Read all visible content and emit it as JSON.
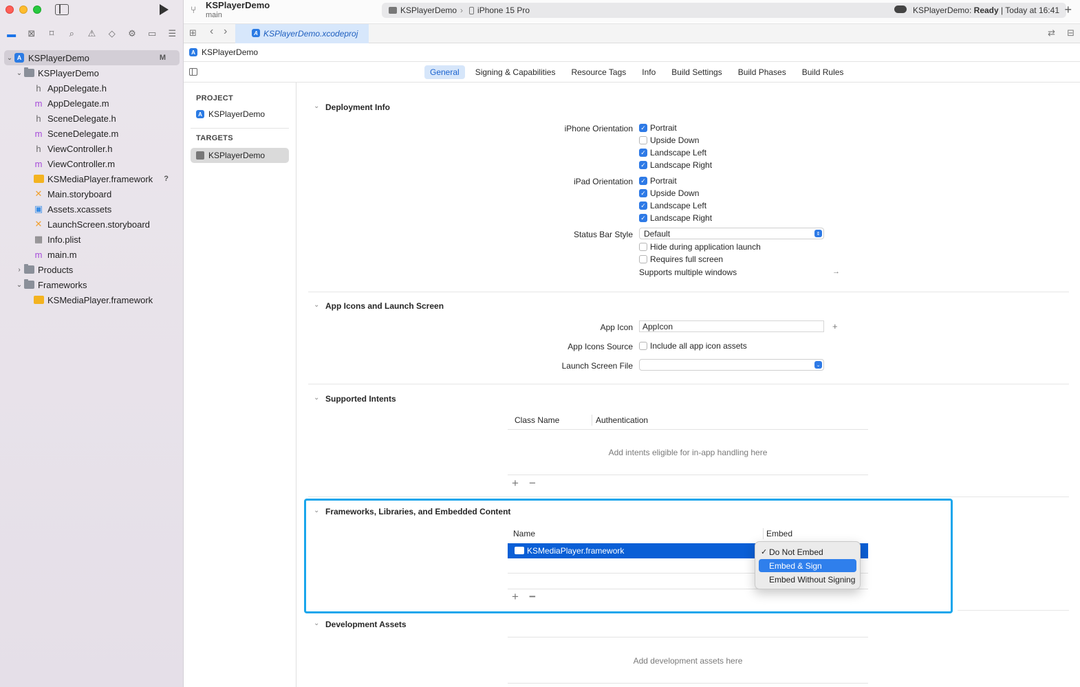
{
  "toolbar": {
    "project_name": "KSPlayerDemo",
    "branch": "main",
    "scheme": "KSPlayerDemo",
    "destination": "iPhone 15 Pro",
    "status_app": "KSPlayerDemo:",
    "status_state": "Ready",
    "status_time": "| Today at 16:41"
  },
  "tab": {
    "file": "KSPlayerDemo.xcodeproj"
  },
  "breadcrumb": {
    "item": "KSPlayerDemo"
  },
  "tree": [
    {
      "label": "KSPlayerDemo",
      "badge": "M"
    },
    {
      "label": "KSPlayerDemo"
    },
    {
      "label": "AppDelegate.h"
    },
    {
      "label": "AppDelegate.m"
    },
    {
      "label": "SceneDelegate.h"
    },
    {
      "label": "SceneDelegate.m"
    },
    {
      "label": "ViewController.h"
    },
    {
      "label": "ViewController.m"
    },
    {
      "label": "KSMediaPlayer.framework",
      "badge": "?"
    },
    {
      "label": "Main.storyboard"
    },
    {
      "label": "Assets.xcassets"
    },
    {
      "label": "LaunchScreen.storyboard"
    },
    {
      "label": "Info.plist"
    },
    {
      "label": "main.m"
    },
    {
      "label": "Products"
    },
    {
      "label": "Frameworks"
    },
    {
      "label": "KSMediaPlayer.framework"
    }
  ],
  "editor_tabs": [
    "General",
    "Signing & Capabilities",
    "Resource Tags",
    "Info",
    "Build Settings",
    "Build Phases",
    "Build Rules"
  ],
  "targets": {
    "project_header": "PROJECT",
    "project_item": "KSPlayerDemo",
    "targets_header": "TARGETS",
    "target_item": "KSPlayerDemo"
  },
  "deployment": {
    "title": "Deployment Info",
    "iphone_label": "iPhone Orientation",
    "ipad_label": "iPad Orientation",
    "iphone": [
      {
        "label": "Portrait",
        "checked": true
      },
      {
        "label": "Upside Down",
        "checked": false
      },
      {
        "label": "Landscape Left",
        "checked": true
      },
      {
        "label": "Landscape Right",
        "checked": true
      }
    ],
    "ipad": [
      {
        "label": "Portrait",
        "checked": true
      },
      {
        "label": "Upside Down",
        "checked": true
      },
      {
        "label": "Landscape Left",
        "checked": true
      },
      {
        "label": "Landscape Right",
        "checked": true
      }
    ],
    "status_bar_label": "Status Bar Style",
    "status_bar_value": "Default",
    "hide_launch": "Hide during application launch",
    "full_screen": "Requires full screen",
    "multiple_windows": "Supports multiple windows"
  },
  "app_icons": {
    "title": "App Icons and Launch Screen",
    "app_icon_label": "App Icon",
    "app_icon_value": "AppIcon",
    "source_label": "App Icons Source",
    "source_checkbox": "Include all app icon assets",
    "launch_label": "Launch Screen File",
    "launch_value": ""
  },
  "intents": {
    "title": "Supported Intents",
    "col1": "Class Name",
    "col2": "Authentication",
    "placeholder": "Add intents eligible for in-app handling here"
  },
  "frameworks": {
    "title": "Frameworks, Libraries, and Embedded Content",
    "col_name": "Name",
    "col_embed": "Embed",
    "row_name": "KSMediaPlayer.framework"
  },
  "embed_menu": {
    "items": [
      "Do Not Embed",
      "Embed & Sign",
      "Embed Without Signing"
    ],
    "checked": "✓"
  },
  "dev_assets": {
    "title": "Development Assets",
    "placeholder": "Add development assets here"
  },
  "colors": {
    "accent": "#2e7ae6",
    "selection": "#0a5fd6",
    "highlight_border": "#1aa6ec"
  }
}
